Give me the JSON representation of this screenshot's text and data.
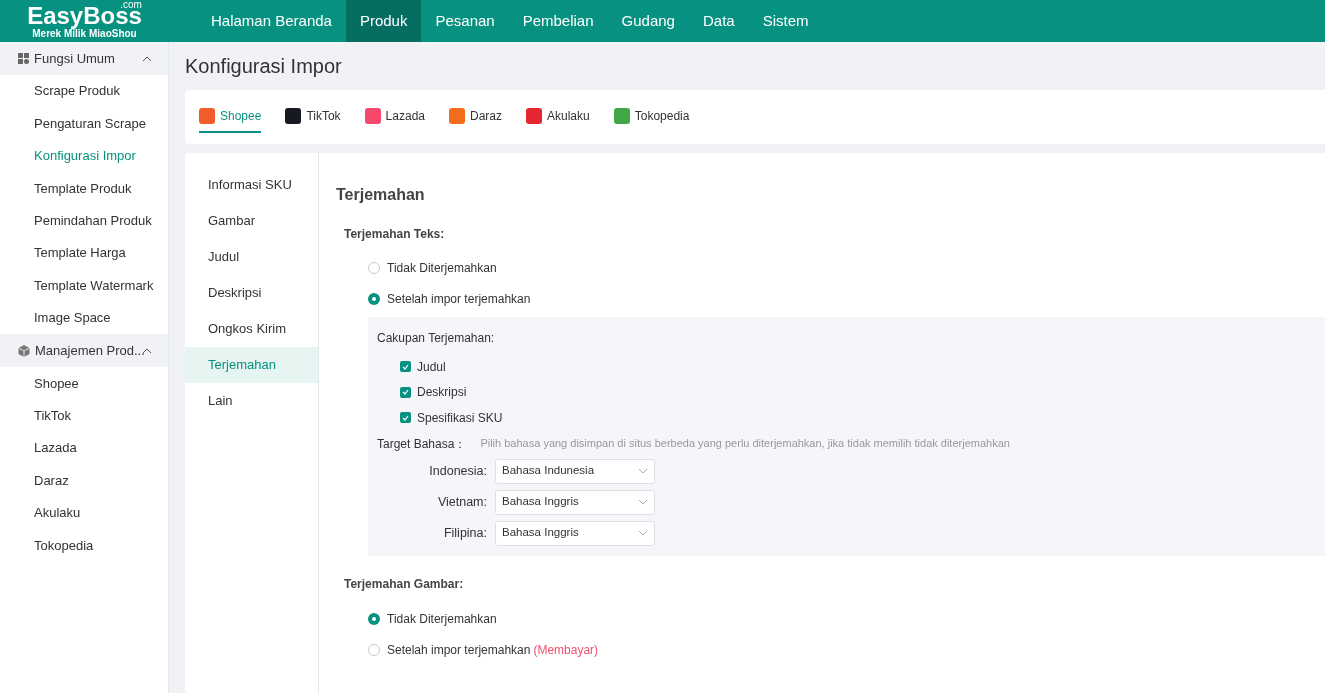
{
  "logo": {
    "name": "EasyBoss",
    "domain": ".com",
    "tagline": "Merek Milik MiaoShou"
  },
  "nav": [
    {
      "label": "Halaman Beranda",
      "selected": false
    },
    {
      "label": "Produk",
      "selected": true
    },
    {
      "label": "Pesanan",
      "selected": false
    },
    {
      "label": "Pembelian",
      "selected": false
    },
    {
      "label": "Gudang",
      "selected": false
    },
    {
      "label": "Data",
      "selected": false
    },
    {
      "label": "Sistem",
      "selected": false
    }
  ],
  "sidebar": [
    {
      "label": "Fungsi Umum",
      "kind": "grid",
      "expanded": true,
      "children": [
        {
          "label": "Scrape Produk",
          "selected": false
        },
        {
          "label": "Pengaturan Scrape",
          "selected": false
        },
        {
          "label": "Konfigurasi Impor",
          "selected": true
        },
        {
          "label": "Template Produk",
          "selected": false
        },
        {
          "label": "Pemindahan Produk",
          "selected": false
        },
        {
          "label": "Template Harga",
          "selected": false
        },
        {
          "label": "Template Watermark",
          "selected": false
        },
        {
          "label": "Image Space",
          "selected": false
        }
      ]
    },
    {
      "label": "Manajemen Prod...",
      "kind": "box",
      "expanded": true,
      "children": [
        {
          "label": "Shopee",
          "selected": false
        },
        {
          "label": "TikTok",
          "selected": false
        },
        {
          "label": "Lazada",
          "selected": false
        },
        {
          "label": "Daraz",
          "selected": false
        },
        {
          "label": "Akulaku",
          "selected": false
        },
        {
          "label": "Tokopedia",
          "selected": false
        }
      ]
    }
  ],
  "page_title": "Konfigurasi Impor",
  "platform_tabs": [
    {
      "label": "Shopee",
      "color": "#f05d2c",
      "selected": true
    },
    {
      "label": "TikTok",
      "color": "#161823",
      "selected": false
    },
    {
      "label": "Lazada",
      "color": "#f5486b",
      "selected": false
    },
    {
      "label": "Daraz",
      "color": "#f36b1c",
      "selected": false
    },
    {
      "label": "Akulaku",
      "color": "#e3262f",
      "selected": false
    },
    {
      "label": "Tokopedia",
      "color": "#42a845",
      "selected": false
    }
  ],
  "sections": [
    {
      "label": "Informasi SKU",
      "selected": false
    },
    {
      "label": "Gambar",
      "selected": false
    },
    {
      "label": "Judul",
      "selected": false
    },
    {
      "label": "Deskripsi",
      "selected": false
    },
    {
      "label": "Ongkos Kirim",
      "selected": false
    },
    {
      "label": "Terjemahan",
      "selected": true
    },
    {
      "label": "Lain",
      "selected": false
    }
  ],
  "heading": "Terjemahan",
  "text_translation": {
    "label": "Terjemahan Teks:",
    "options": [
      {
        "label": "Tidak Diterjemahkan",
        "selected": false
      },
      {
        "label": "Setelah impor terjemahkan",
        "selected": true
      }
    ],
    "scope_label": "Cakupan Terjemahan:",
    "scope": [
      {
        "label": "Judul",
        "checked": true
      },
      {
        "label": "Deskripsi",
        "checked": true
      },
      {
        "label": "Spesifikasi SKU",
        "checked": true
      }
    ],
    "target_label": "Target Bahasa：",
    "target_hint": "Pilih bahasa yang disimpan di situs berbeda yang perlu diterjemahkan, jika tidak memilih tidak diterjemahkan",
    "targets": [
      {
        "label": "Indonesia:",
        "value": "Bahasa Indunesia"
      },
      {
        "label": "Vietnam:",
        "value": "Bahasa Inggris"
      },
      {
        "label": "Filipina:",
        "value": "Bahasa Inggris"
      }
    ]
  },
  "image_translation": {
    "label": "Terjemahan Gambar:",
    "options": [
      {
        "label": "Tidak Diterjemahkan",
        "selected": true
      },
      {
        "label": "Setelah impor terjemahkan",
        "note": "(Membayar)",
        "selected": false
      }
    ]
  }
}
